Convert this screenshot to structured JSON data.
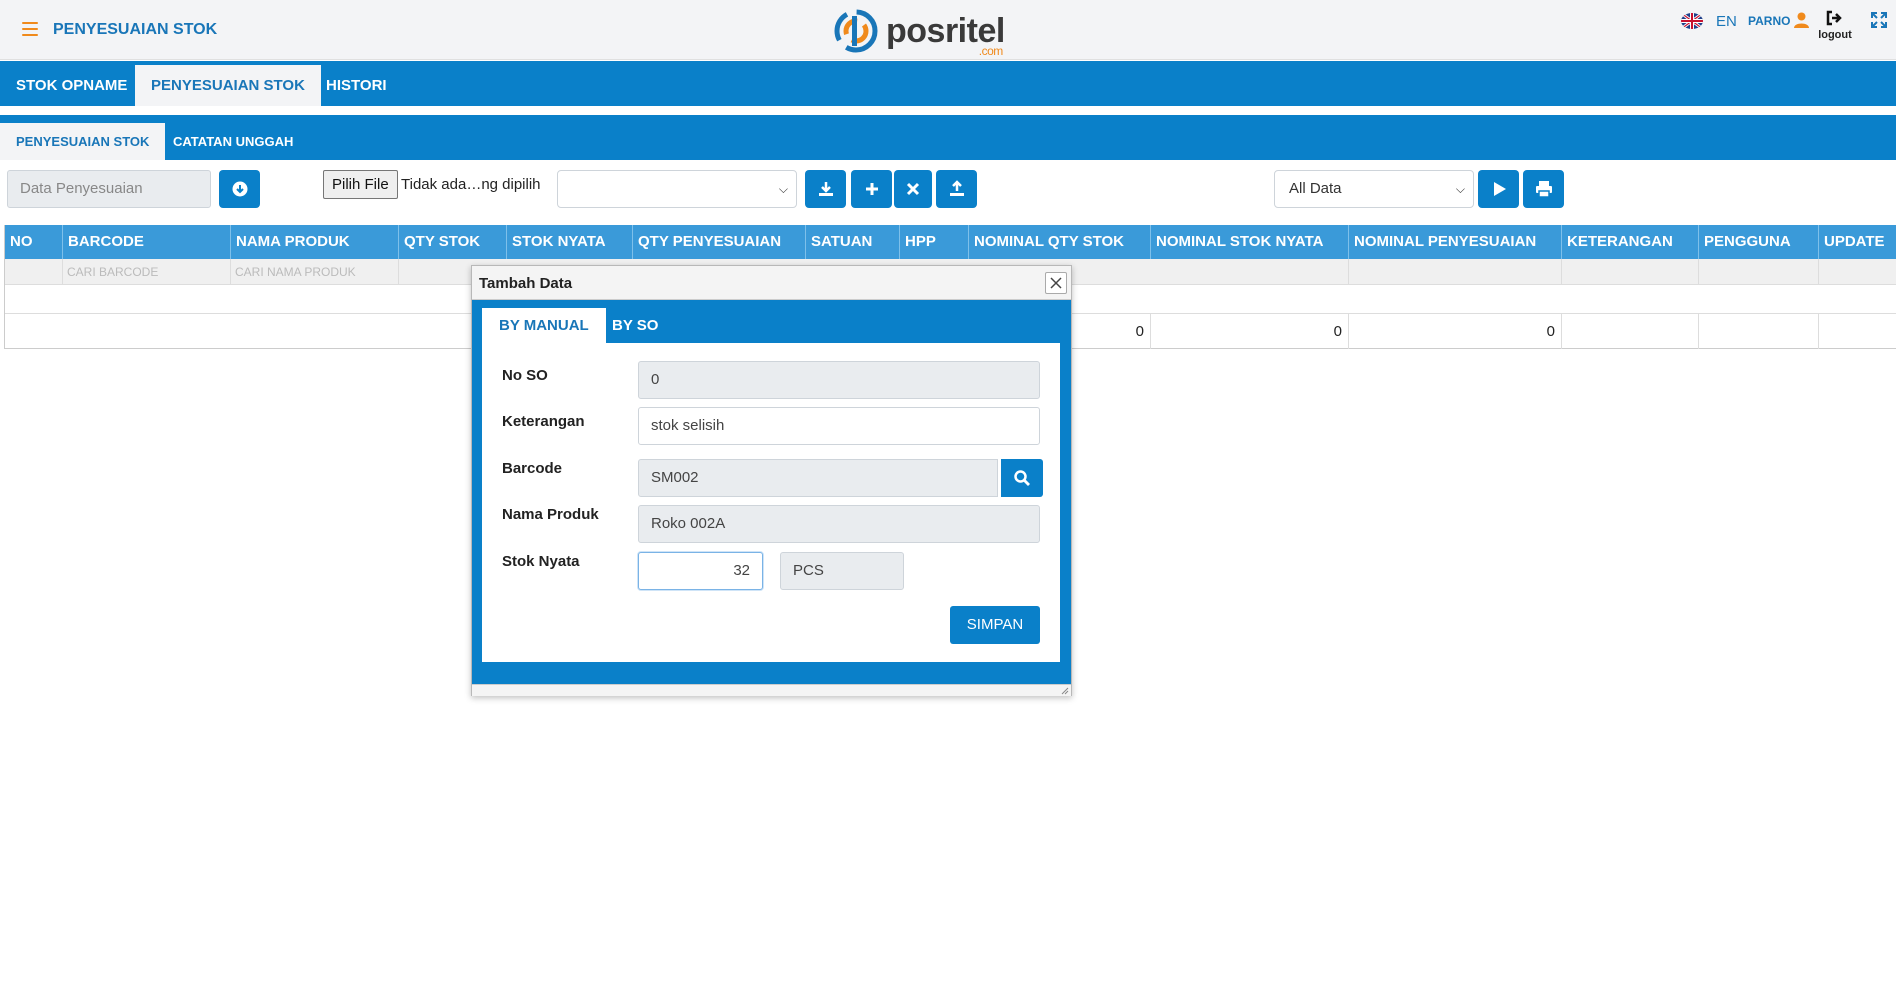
{
  "header": {
    "page_title": "PENYESUAIAN STOK",
    "logo": "posritel",
    "logo_suffix": ".com",
    "language": "EN",
    "user": "PARNO",
    "logout_label": "logout",
    "accent": "#0a80c9",
    "brand_orange": "#f08a1c"
  },
  "main_tabs": [
    {
      "label": "STOK OPNAME",
      "active": false
    },
    {
      "label": "PENYESUAIAN STOK",
      "active": true
    },
    {
      "label": "HISTORI",
      "active": false
    }
  ],
  "sub_tabs": [
    {
      "label": "PENYESUAIAN STOK",
      "active": true
    },
    {
      "label": "CATATAN UNGGAH",
      "active": false
    }
  ],
  "toolbar": {
    "data_placeholder": "Data Penyesuaian",
    "file_button": "Pilih File",
    "file_status": "Tidak ada…ng dipilih",
    "select_value": "",
    "filter_value": "All Data",
    "icons": [
      "download-circle",
      "download",
      "plus",
      "times",
      "upload",
      "play",
      "print"
    ]
  },
  "grid": {
    "columns": [
      "NO",
      "BARCODE",
      "NAMA PRODUK",
      "QTY STOK",
      "STOK NYATA",
      "QTY PENYESUAIAN",
      "SATUAN",
      "HPP",
      "NOMINAL QTY STOK",
      "NOMINAL STOK NYATA",
      "NOMINAL PENYESUAIAN",
      "KETERANGAN",
      "PENGGUNA",
      "UPDATE"
    ],
    "filters": {
      "barcode": "CARI BARCODE",
      "nama_produk": "CARI NAMA PRODUK"
    },
    "totals": {
      "nominal_qty_stok": "0",
      "nominal_stok_nyata": "0",
      "nominal_penyesuaian": "0"
    }
  },
  "dialog": {
    "title": "Tambah Data",
    "tabs": [
      {
        "label": "BY MANUAL",
        "active": true
      },
      {
        "label": "BY SO",
        "active": false
      }
    ],
    "fields": {
      "no_so": {
        "label": "No SO",
        "value": "0"
      },
      "keterangan": {
        "label": "Keterangan",
        "value": "stok selisih"
      },
      "barcode": {
        "label": "Barcode",
        "value": "SM002"
      },
      "nama_produk": {
        "label": "Nama Produk",
        "value": "Roko 002A"
      },
      "stok_nyata": {
        "label": "Stok Nyata",
        "value": "32",
        "unit": "PCS"
      }
    },
    "save_label": "SIMPAN"
  }
}
